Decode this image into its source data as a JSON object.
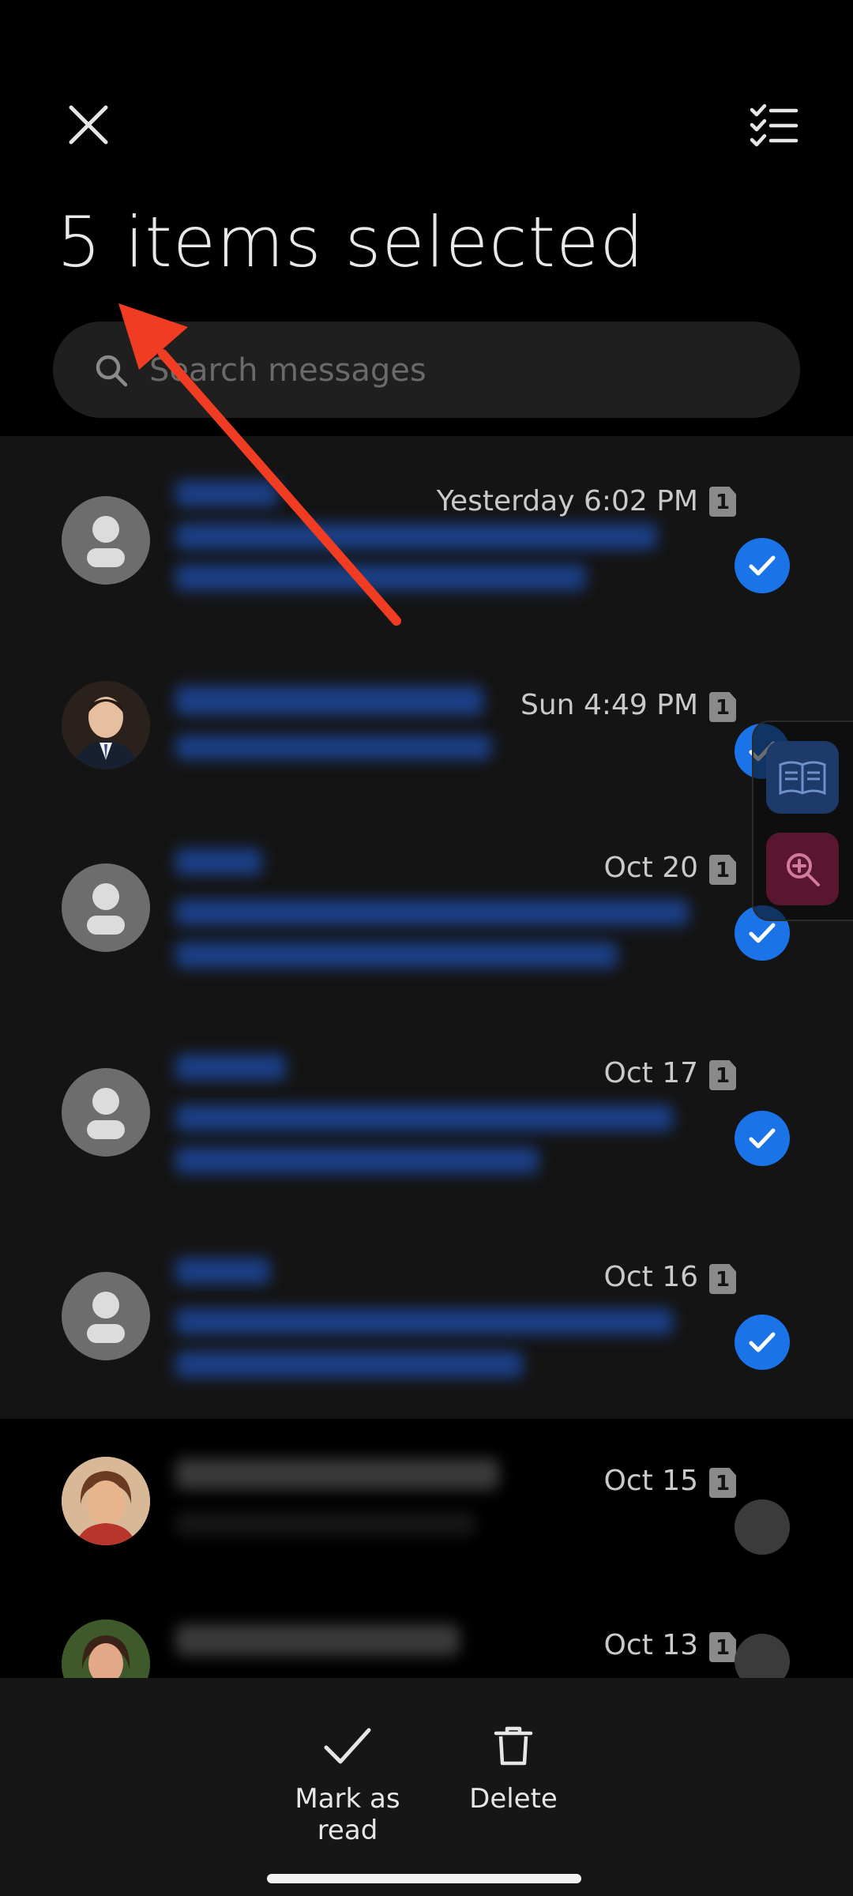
{
  "header": {
    "close_icon": "close-icon",
    "select_all_icon": "checklist-icon",
    "title": "5 items selected"
  },
  "search": {
    "placeholder": "Search messages",
    "icon": "search-icon"
  },
  "conversations": [
    {
      "time": "Yesterday 6:02 PM",
      "sim": "1",
      "selected": true,
      "avatar": "default-avatar"
    },
    {
      "time": "Sun 4:49 PM",
      "sim": "1",
      "selected": true,
      "avatar": "photo-avatar"
    },
    {
      "time": "Oct 20",
      "sim": "1",
      "selected": true,
      "avatar": "default-avatar"
    },
    {
      "time": "Oct 17",
      "sim": "1",
      "selected": true,
      "avatar": "default-avatar"
    },
    {
      "time": "Oct 16",
      "sim": "1",
      "selected": true,
      "avatar": "default-avatar"
    },
    {
      "time": "Oct 15",
      "sim": "1",
      "selected": false,
      "avatar": "photo-avatar"
    },
    {
      "time": "Oct 13",
      "sim": "1",
      "selected": false,
      "avatar": "photo-avatar"
    }
  ],
  "floating_tools": [
    "reader-icon",
    "zoom-icon"
  ],
  "bottom_actions": {
    "mark_read": "Mark as read",
    "delete": "Delete"
  },
  "colors": {
    "accent": "#1b73e8",
    "annotation_arrow": "#f03c22",
    "background": "#000000",
    "selected_row": "#141414"
  }
}
